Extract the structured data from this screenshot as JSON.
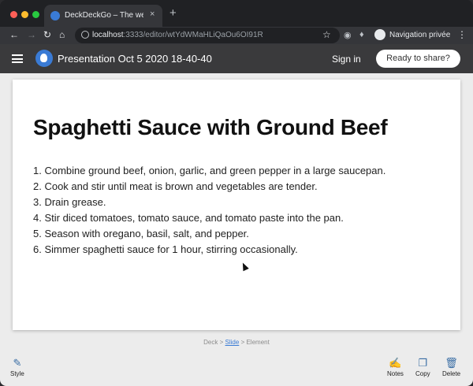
{
  "browser": {
    "tab_title": "DeckDeckGo – The web open",
    "tab_close": "×",
    "new_tab": "+",
    "url_host": "localhost",
    "url_rest": ":3333/editor/wtYdWMaHLiQaOu6OI91R",
    "profile_label": "Navigation privée"
  },
  "app": {
    "presentation_title": "Presentation Oct 5 2020 18-40-40",
    "sign_in": "Sign in",
    "share_label": "Ready to share?"
  },
  "slide": {
    "title": "Spaghetti Sauce with Ground Beef",
    "steps": [
      "1. Combine ground beef, onion, garlic, and green pepper in a large saucepan.",
      "2. Cook and stir until meat is brown and vegetables are tender.",
      "3. Drain grease.",
      "4. Stir diced tomatoes, tomato sauce, and tomato paste into the pan.",
      "5. Season with oregano, basil, salt, and pepper.",
      "6. Simmer spaghetti sauce for 1 hour, stirring occasionally."
    ]
  },
  "breadcrumb": {
    "deck": "Deck",
    "sep": ">",
    "slide": "Slide",
    "element": "Element"
  },
  "footer": {
    "style": "Style",
    "notes": "Notes",
    "copy": "Copy",
    "delete": "Delete"
  },
  "icons": {
    "back": "back-arrow-icon",
    "forward": "forward-arrow-icon",
    "reload": "reload-icon",
    "home": "home-icon",
    "star": "star-icon",
    "menu": "hamburger-menu-icon",
    "style": "brush-icon",
    "notes": "edit-icon",
    "copy": "copy-icon",
    "delete": "trash-icon"
  },
  "colors": {
    "accent": "#3a7bd5",
    "header_bg": "#3a3a3c"
  }
}
